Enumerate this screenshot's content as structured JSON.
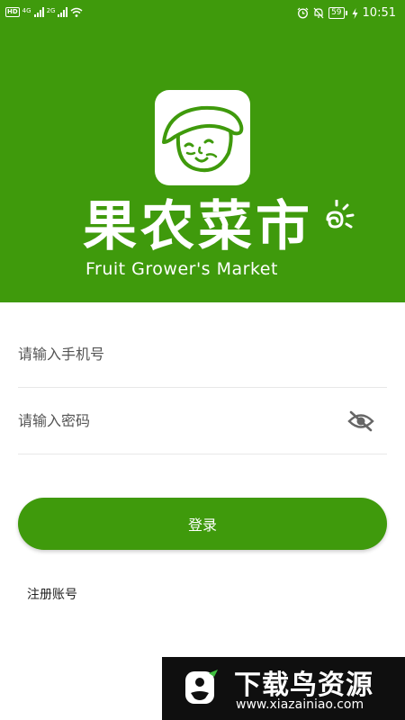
{
  "status_bar": {
    "hd": "HD",
    "net1": "4G",
    "net2": "2G",
    "battery": "59",
    "time": "10:51"
  },
  "brand": {
    "name_cn": "果农菜市",
    "name_en": "Fruit Grower's Market"
  },
  "login_form": {
    "phone_placeholder": "请输入手机号",
    "password_placeholder": "请输入密码",
    "login_label": "登录",
    "register_label": "注册账号"
  },
  "watermark": {
    "name_cn": "下载鸟资源",
    "url": "www.xiazainiao.com"
  },
  "colors": {
    "primary": "#3f9a0c",
    "white": "#ffffff",
    "watermark_bg": "#0f0f0f"
  },
  "icons": [
    "signal-icon",
    "wifi-icon",
    "alarm-icon",
    "mute-icon",
    "battery-icon",
    "charging-icon",
    "eye-off-icon"
  ]
}
